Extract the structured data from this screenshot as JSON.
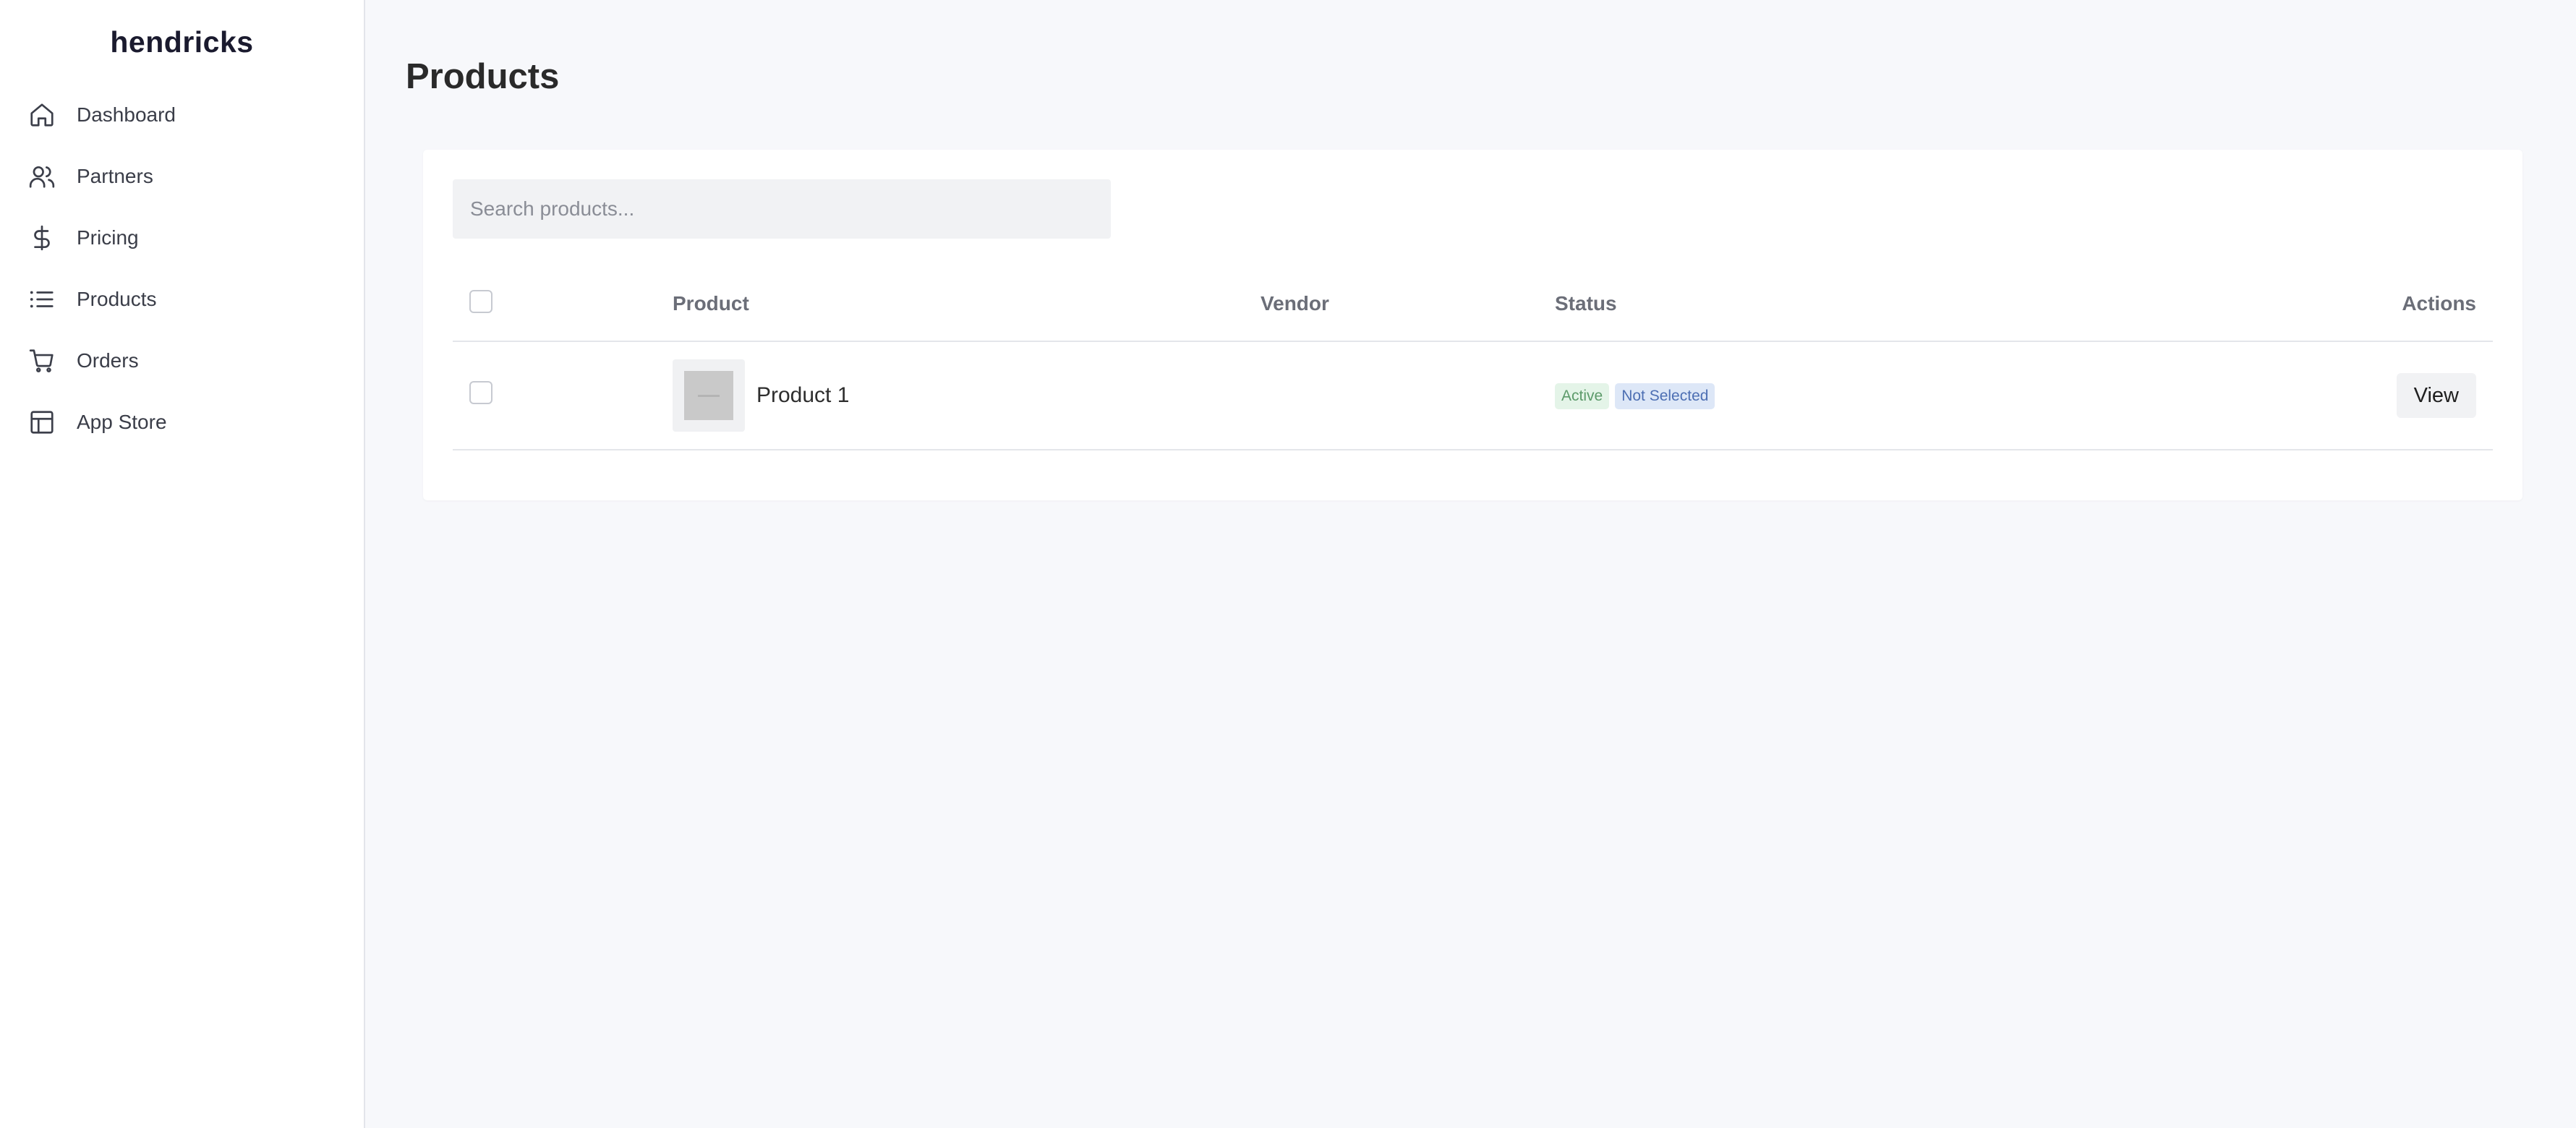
{
  "sidebar": {
    "brand": "hendricks",
    "items": [
      {
        "label": "Dashboard",
        "icon": "home-icon"
      },
      {
        "label": "Partners",
        "icon": "users-icon"
      },
      {
        "label": "Pricing",
        "icon": "dollar-icon"
      },
      {
        "label": "Products",
        "icon": "list-icon"
      },
      {
        "label": "Orders",
        "icon": "cart-icon"
      },
      {
        "label": "App Store",
        "icon": "layout-icon"
      }
    ]
  },
  "main": {
    "title": "Products",
    "search": {
      "placeholder": "Search products...",
      "value": ""
    },
    "table": {
      "columns": [
        "Product",
        "Vendor",
        "Status",
        "Actions"
      ],
      "rows": [
        {
          "product": "Product 1",
          "vendor": "",
          "status": [
            "Active",
            "Not Selected"
          ],
          "action": "View"
        }
      ]
    }
  },
  "colors": {
    "background": "#f7f8fb",
    "badge_active_bg": "#e4f4e8",
    "badge_active_text": "#5c9a6a",
    "badge_not_selected_bg": "#dde7f7",
    "badge_not_selected_text": "#4d6fb3"
  }
}
